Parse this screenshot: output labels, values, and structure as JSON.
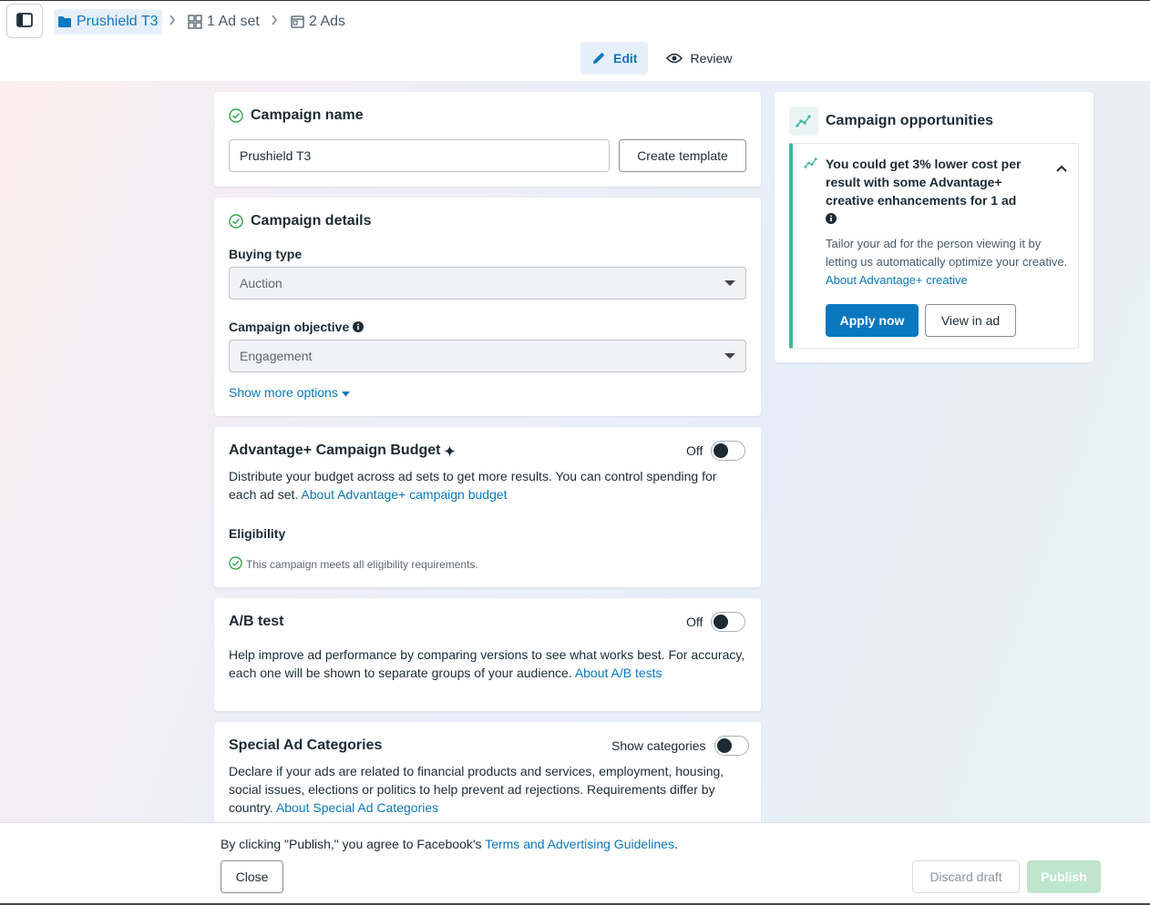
{
  "breadcrumb": {
    "campaign": "Prushield T3",
    "ad_set": "1 Ad set",
    "ads": "2 Ads"
  },
  "mode_tabs": {
    "edit": "Edit",
    "review": "Review"
  },
  "campaign_name_card": {
    "title": "Campaign name",
    "name_value": "Prushield T3",
    "create_template": "Create template"
  },
  "campaign_details": {
    "title": "Campaign details",
    "buying_type_label": "Buying type",
    "buying_type_value": "Auction",
    "objective_label": "Campaign objective",
    "objective_value": "Engagement",
    "show_more": "Show more options"
  },
  "budget": {
    "title": "Advantage+ Campaign Budget",
    "toggle_label": "Off",
    "desc": "Distribute your budget across ad sets to get more results. You can control spending for each ad set.",
    "link": "About Advantage+ campaign budget",
    "eligibility_label": "Eligibility",
    "eligibility_text": "This campaign meets all eligibility requirements."
  },
  "ab_test": {
    "title": "A/B test",
    "toggle_label": "Off",
    "desc": "Help improve ad performance by comparing versions to see what works best. For accuracy, each one will be shown to separate groups of your audience.",
    "link": "About A/B tests"
  },
  "special_categories": {
    "title": "Special Ad Categories",
    "toggle_label": "Show categories",
    "desc": "Declare if your ads are related to financial products and services, employment, housing, social issues, elections or politics to help prevent ad rejections. Requirements differ by country.",
    "link": "About Special Ad Categories"
  },
  "opportunities": {
    "title": "Campaign opportunities",
    "headline": "You could get 3% lower cost per result with some Advantage+ creative enhancements for 1 ad",
    "body": "Tailor your ad for the person viewing it by letting us automatically optimize your creative.",
    "link": "About Advantage+ creative",
    "apply": "Apply now",
    "view": "View in ad"
  },
  "footer": {
    "agree_text": "By clicking \"Publish,\" you agree to Facebook's",
    "terms_link": "Terms and Advertising Guidelines",
    "period": ".",
    "close": "Close",
    "discard": "Discard draft",
    "publish": "Publish"
  },
  "colors": {
    "accent": "#0a78be",
    "success": "#31a24c",
    "teal": "#3fb5a0"
  }
}
